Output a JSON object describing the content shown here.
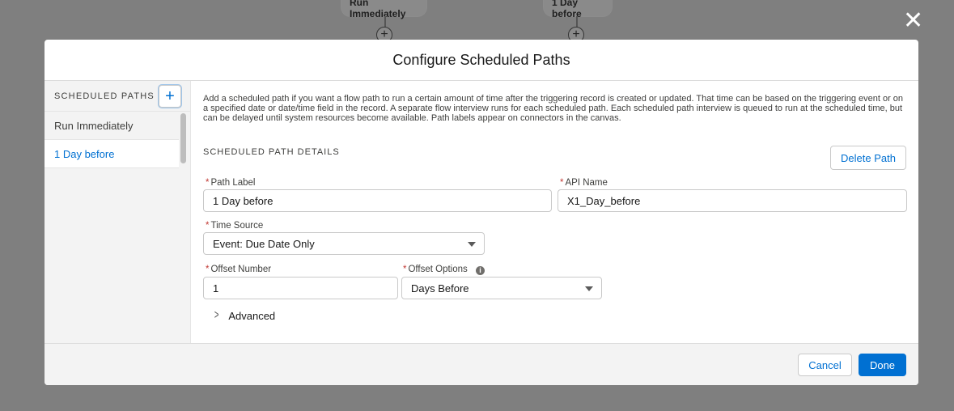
{
  "canvas": {
    "node_run": "Run Immediately",
    "node_1day": "1 Day before",
    "plus_glyph": "+"
  },
  "close_glyph": "✕",
  "modal": {
    "title": "Configure Scheduled Paths"
  },
  "sidebar": {
    "title": "SCHEDULED PATHS",
    "add_glyph": "+",
    "items": [
      {
        "label": "Run Immediately"
      },
      {
        "label": "1 Day before"
      }
    ]
  },
  "content": {
    "description": "Add a scheduled path if you want a flow path to run a certain amount of time after the triggering record is created or updated. That time can be based on the triggering event or on a specified date or date/time field in the record. A separate flow interview runs for each scheduled path. Each scheduled path interview is queued to run at the scheduled time, but can be delayed until system resources become available. Path labels appear on connectors in the canvas.",
    "section_title": "SCHEDULED PATH DETAILS",
    "delete_label": "Delete Path",
    "required_mark": "*",
    "fields": {
      "path_label": {
        "label": "Path Label",
        "value": "1 Day before"
      },
      "api_name": {
        "label": "API Name",
        "value": "X1_Day_before"
      },
      "time_source": {
        "label": "Time Source",
        "value": "Event: Due Date Only"
      },
      "offset_number": {
        "label": "Offset Number",
        "value": "1"
      },
      "offset_options": {
        "label": "Offset Options",
        "value": "Days Before"
      }
    },
    "info_glyph": "i",
    "advanced_label": "Advanced",
    "chevron_glyph": ">"
  },
  "footer": {
    "cancel_label": "Cancel",
    "done_label": "Done"
  },
  "colors": {
    "brand": "#0070d2",
    "required": "#c23934",
    "overlay": "#7f7f7f"
  }
}
